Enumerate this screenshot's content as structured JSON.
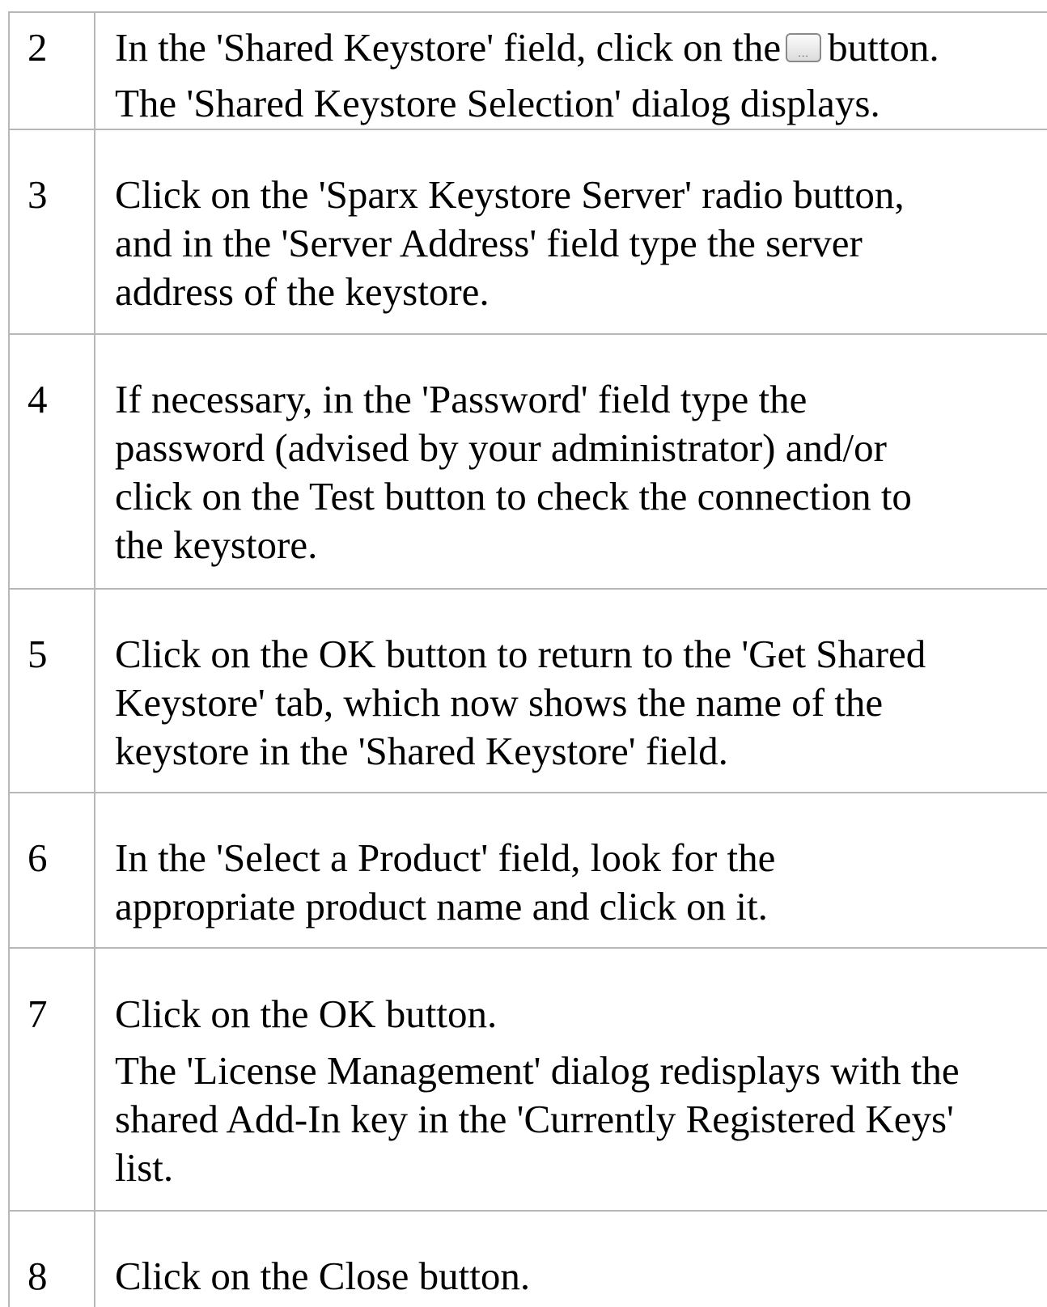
{
  "steps": [
    {
      "number": "2",
      "line_1_before": "In the 'Shared Keystore' field, click on the",
      "line_1_after": "button.",
      "line_2": "The 'Shared Keystore Selection' dialog displays."
    },
    {
      "number": "3",
      "lines": [
        "Click on the 'Sparx Keystore Server' radio button,",
        "and in the 'Server Address' field type the server",
        "address of the keystore."
      ]
    },
    {
      "number": "4",
      "lines": [
        "If necessary, in the 'Password' field type the",
        "password (advised by your administrator) and/or",
        "click on the Test button to check the connection to",
        "the keystore."
      ]
    },
    {
      "number": "5",
      "lines": [
        "Click on the OK button to return to the 'Get Shared",
        "Keystore' tab, which now shows the name of the",
        "keystore in the 'Shared Keystore' field."
      ]
    },
    {
      "number": "6",
      "lines": [
        "In the 'Select a Product' field, look for the",
        "appropriate product name and click on it."
      ]
    },
    {
      "number": "7",
      "line_1": "Click on the OK button.",
      "lines_2": [
        "The 'License Management' dialog redisplays with the",
        "shared Add-In key in the 'Currently Registered Keys'",
        "list."
      ]
    },
    {
      "number": "8",
      "lines": [
        "Click on the Close button."
      ]
    }
  ],
  "browse_button": {
    "icon": "ellipsis-button-icon",
    "glyph": "..."
  },
  "colors": {
    "grid_line": "#b7b7b7",
    "text": "#000000",
    "background": "#ffffff"
  }
}
